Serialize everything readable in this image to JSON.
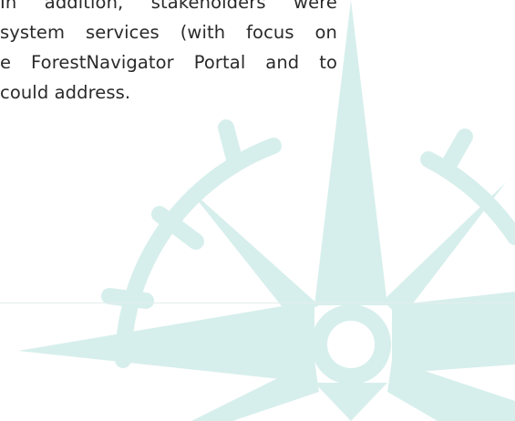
{
  "body_text": {
    "lines": [
      "In addition, stakeholders were",
      "system services (with focus on",
      "e ForestNavigator Portal and to",
      "could address."
    ]
  },
  "colors": {
    "text": "#2a2a2a",
    "watermark": "#d7efec",
    "background": "#ffffff"
  },
  "watermark_icon": "compass-rose-icon"
}
